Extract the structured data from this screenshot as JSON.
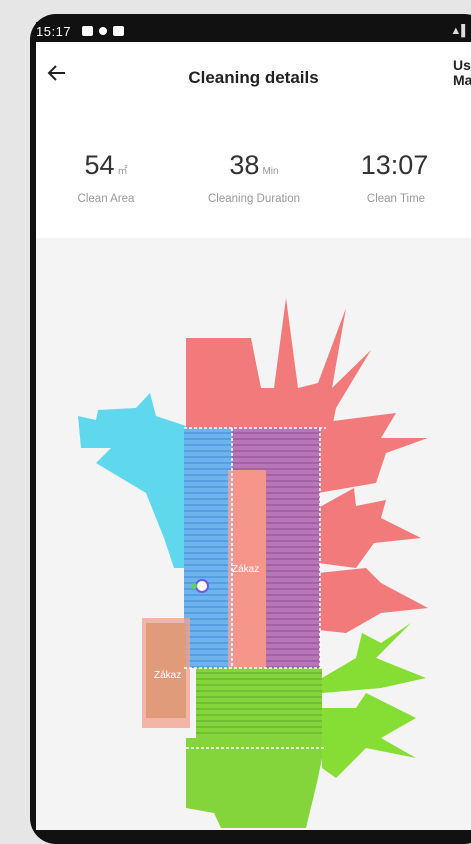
{
  "status_bar": {
    "time": "15:17"
  },
  "header": {
    "title": "Cleaning details",
    "right_partial": "Us\nMa",
    "back_icon": "arrow-left-icon"
  },
  "stats": [
    {
      "value": "54",
      "unit": "㎡",
      "label": "Clean Area"
    },
    {
      "value": "38",
      "unit": "Min",
      "label": "Cleaning Duration"
    },
    {
      "value": "13:07",
      "unit": "",
      "label": "Clean Time"
    }
  ],
  "map": {
    "zones": [
      {
        "label": "Zákaz"
      },
      {
        "label": "Zákaz"
      }
    ],
    "colors": {
      "room_red": "#f27a7a",
      "room_cyan": "#5fd8ee",
      "room_purple": "#b56fb6",
      "room_green": "#86dd34",
      "room_blue": "#5aa8ee",
      "no_go_zone": "#f4a090"
    }
  }
}
